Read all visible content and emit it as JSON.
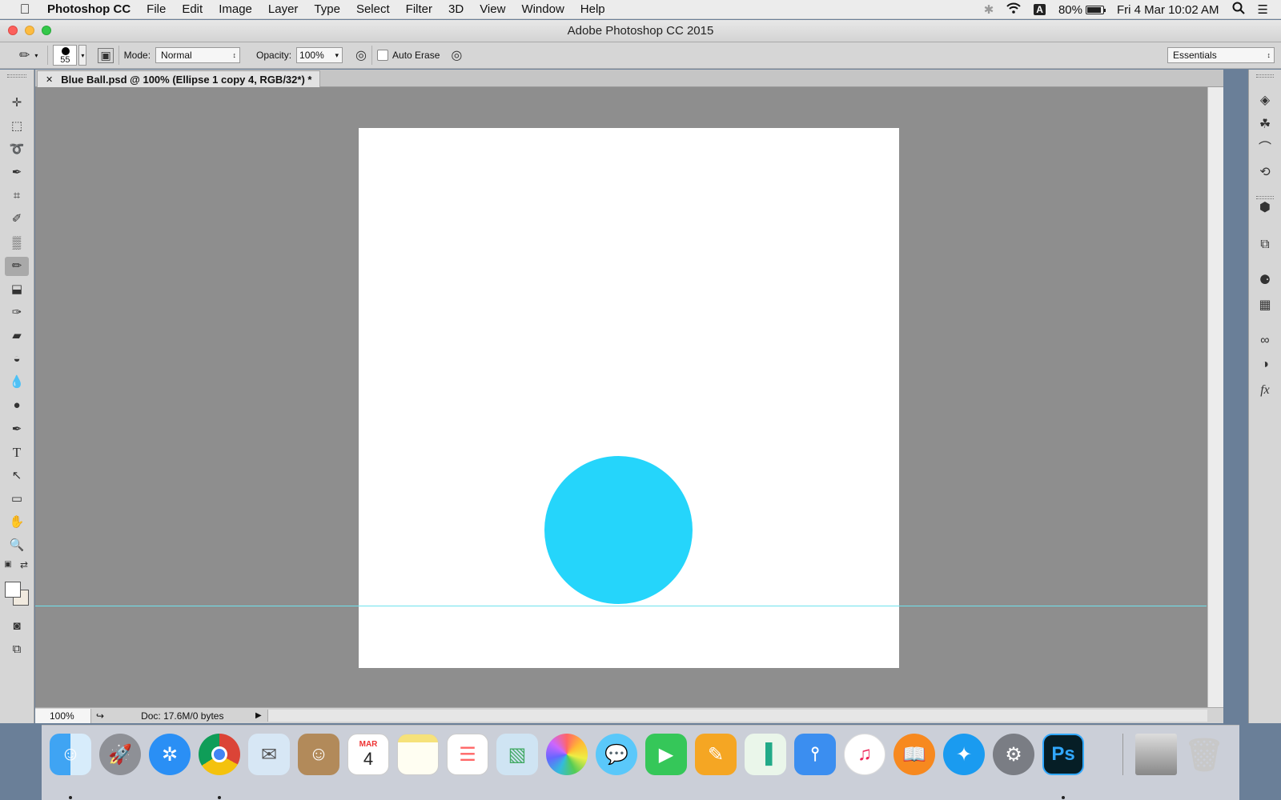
{
  "menubar": {
    "app_name": "Photoshop CC",
    "items": [
      "File",
      "Edit",
      "Image",
      "Layer",
      "Type",
      "Select",
      "Filter",
      "3D",
      "View",
      "Window",
      "Help"
    ],
    "battery": "80%",
    "datetime": "Fri 4 Mar  10:02 AM",
    "input_source": "A",
    "icons": [
      "apple-icon",
      "bluetooth-icon",
      "wifi-icon",
      "battery-icon",
      "spotlight-icon",
      "notification-center-icon"
    ]
  },
  "window": {
    "title": "Adobe Photoshop CC 2015"
  },
  "options": {
    "brush_size": "55",
    "mode_label": "Mode:",
    "mode_value": "Normal",
    "opacity_label": "Opacity:",
    "opacity_value": "100%",
    "auto_erase_label": "Auto Erase",
    "auto_erase_checked": false,
    "workspace": "Essentials"
  },
  "document": {
    "tab_title": "Blue Ball.psd @ 100% (Ellipse 1 copy 4, RGB/32*) *",
    "zoom": "100%",
    "doc_info": "Doc: 17.6M/0 bytes",
    "ball_color": "#25d5fb",
    "guide_color": "#6ee3ee"
  },
  "tools": [
    "move-tool",
    "marquee-tool",
    "lasso-tool",
    "quick-selection-tool",
    "crop-tool",
    "eyedropper-tool",
    "spot-healing-tool",
    "pencil-tool",
    "clone-stamp-tool",
    "history-brush-tool",
    "eraser-tool",
    "paint-bucket-tool",
    "blur-tool",
    "dodge-tool",
    "pen-tool",
    "type-tool",
    "path-selection-tool",
    "rectangle-tool",
    "hand-tool",
    "zoom-tool"
  ],
  "active_tool": "pencil-tool",
  "right_panels": [
    "layers",
    "channels",
    "paths",
    "adjustments",
    "3d",
    "properties",
    "swatches",
    "grid",
    "libraries",
    "styles",
    "fx"
  ],
  "dock_apps": [
    "Finder",
    "Launchpad",
    "Safari",
    "Chrome",
    "Mail",
    "Contacts",
    "Calendar",
    "Notes",
    "Reminders",
    "Preview",
    "Photos",
    "Messages",
    "FaceTime",
    "Pages",
    "Numbers",
    "Keynote",
    "iTunes",
    "iBooks",
    "App Store",
    "System Preferences",
    "Photoshop",
    "Photo",
    "Trash"
  ],
  "calendar_badge": {
    "month": "MAR",
    "day": "4"
  },
  "photoshop_icon_label": "Ps"
}
